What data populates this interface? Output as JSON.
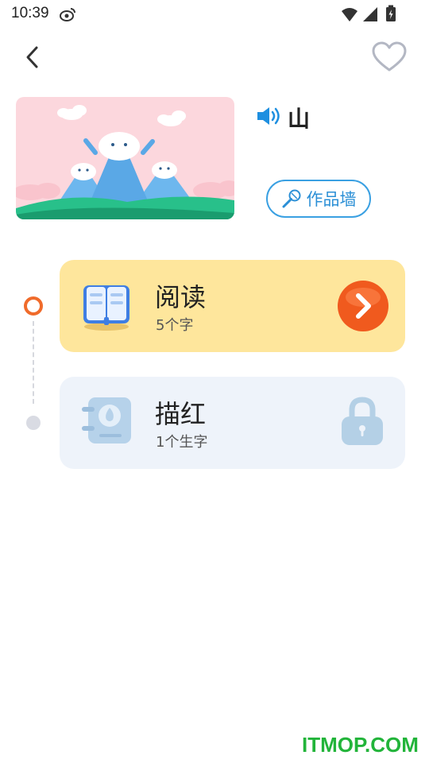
{
  "status_bar": {
    "time": "10:39"
  },
  "header": {
    "back_icon": "chevron-left-icon",
    "favorite_icon": "heart-outline-icon"
  },
  "lesson": {
    "character": "山",
    "sound_icon": "speaker-icon"
  },
  "gallery_button": {
    "label": "作品墙",
    "icon": "microphone-icon"
  },
  "steps": [
    {
      "title": "阅读",
      "subtitle": "5个字",
      "icon": "open-book-icon",
      "action_icon": "arrow-right-icon",
      "state": "active"
    },
    {
      "title": "描红",
      "subtitle": "1个生字",
      "icon": "notebook-icon",
      "action_icon": "lock-icon",
      "state": "locked"
    }
  ],
  "watermark": "ITMOP.COM",
  "colors": {
    "accent_blue": "#3aa0e2",
    "active_orange": "#f06b2b",
    "read_card": "#fee69c",
    "locked_card": "#eef3fa"
  }
}
